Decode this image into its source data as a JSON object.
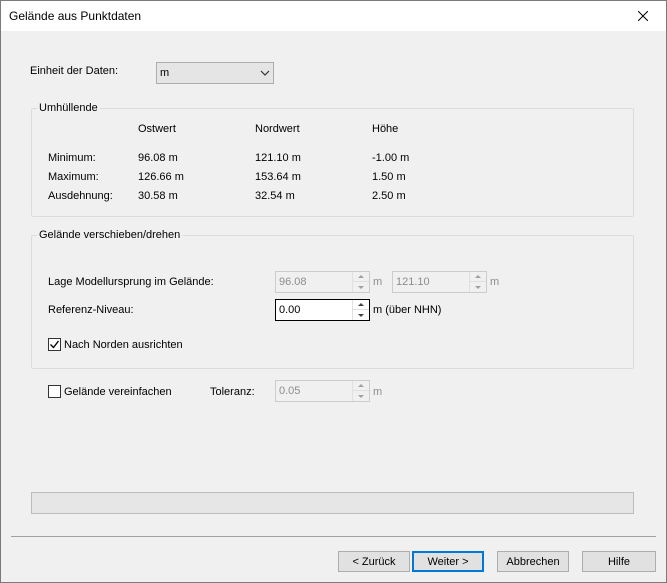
{
  "window": {
    "title": "Gelände aus Punktdaten"
  },
  "unit_row": {
    "label": "Einheit der Daten:",
    "selected": "m"
  },
  "envelope": {
    "title": "Umhüllende",
    "columns": [
      "Ostwert",
      "Nordwert",
      "Höhe"
    ],
    "rows": [
      {
        "label": "Minimum:",
        "values": [
          "96.08 m",
          "121.10 m",
          "-1.00 m"
        ]
      },
      {
        "label": "Maximum:",
        "values": [
          "126.66 m",
          "153.64 m",
          "1.50 m"
        ]
      },
      {
        "label": "Ausdehnung:",
        "values": [
          "30.58 m",
          "32.54 m",
          "2.50 m"
        ]
      }
    ]
  },
  "shift": {
    "title": "Gelände verschieben/drehen",
    "origin_label": "Lage Modellursprung im Gelände:",
    "origin_x": "96.08",
    "origin_y": "121.10",
    "unit": "m",
    "ref_label": "Referenz-Niveau:",
    "ref_value": "0.00",
    "ref_unit": "m (über NHN)",
    "north_label": "Nach Norden ausrichten",
    "north_checked": true
  },
  "simplify": {
    "label": "Gelände vereinfachen",
    "checked": false,
    "tolerance_label": "Toleranz:",
    "tolerance_value": "0.05",
    "unit": "m"
  },
  "progress": {
    "value": 0
  },
  "buttons": {
    "back": "< Zurück",
    "next": "Weiter >",
    "cancel": "Abbrechen",
    "help": "Hilfe"
  },
  "icons": {
    "close": "close-icon",
    "dropdown": "chevron-down-icon",
    "check": "checkmark-icon"
  },
  "colors": {
    "accent": "#0078d7",
    "progress": "#06b025"
  }
}
